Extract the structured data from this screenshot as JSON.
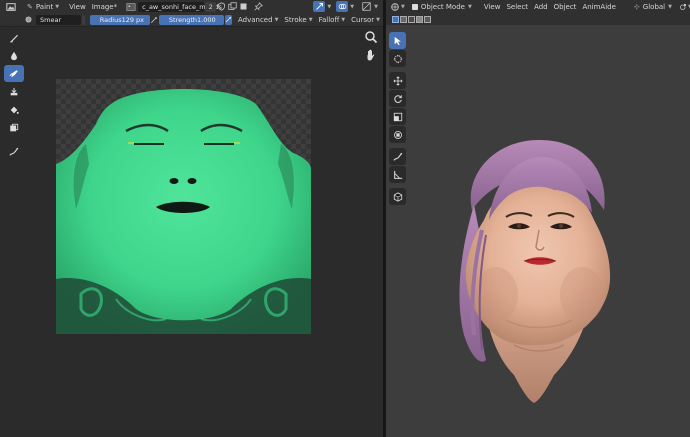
{
  "image_editor": {
    "header": {
      "mode": "Paint",
      "menus": [
        "View",
        "Image*"
      ],
      "image_name": "c_aw_sonhi_face_mt.dds",
      "users": "2"
    },
    "tool_settings": {
      "brush_name": "Smear",
      "radius_label": "Radius",
      "radius_value": "129 px",
      "strength_label": "Strength",
      "strength_value": "1.000",
      "dropdowns": [
        "Advanced",
        "Stroke",
        "Falloff",
        "Cursor"
      ]
    },
    "toolbar_icons": [
      "draw-brush-icon",
      "soften-icon",
      "smear-icon",
      "clone-icon",
      "fill-icon",
      "mask-icon",
      "annotate-icon"
    ],
    "texture": {
      "skin_color": "#3fd68c",
      "background_checker": [
        "#3a3a3a",
        "#2c2c2c"
      ]
    }
  },
  "viewport_3d": {
    "header": {
      "mode": "Object Mode",
      "menus": [
        "View",
        "Select",
        "Add",
        "Object",
        "AnimAide"
      ],
      "transform_orientation": "Global"
    },
    "toolbar_icons": [
      "select-box-icon",
      "cursor-icon",
      "move-icon",
      "rotate-icon",
      "scale-icon",
      "transform-icon",
      "annotate-icon",
      "measure-icon",
      "add-cube-icon"
    ],
    "background_color": "#3d3d3d",
    "accent_color": "#4772b3"
  }
}
